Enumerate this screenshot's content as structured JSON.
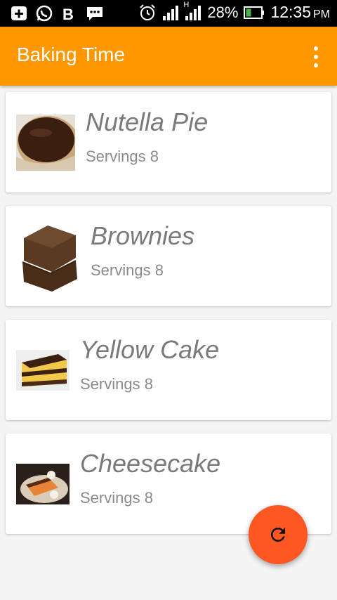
{
  "status_bar": {
    "battery_percent": "28%",
    "time": "12:35",
    "ampm": "PM",
    "network_type": "H",
    "left_icons": [
      "add-box-icon",
      "whatsapp-icon",
      "b-app-icon",
      "chat-bubble-icon"
    ],
    "right_icons": [
      "alarm-icon",
      "signal-icon",
      "signal-h-icon",
      "battery-icon"
    ]
  },
  "app_bar": {
    "title": "Baking Time",
    "color": "#ff9800",
    "menu_icon": "overflow-menu-icon"
  },
  "recipes": [
    {
      "name": "Nutella Pie",
      "servings": "Servings 8",
      "image": "nutella-pie-photo"
    },
    {
      "name": "Brownies",
      "servings": "Servings 8",
      "image": "brownies-photo"
    },
    {
      "name": "Yellow Cake",
      "servings": "Servings 8",
      "image": "yellow-cake-photo"
    },
    {
      "name": "Cheesecake",
      "servings": "Servings 8",
      "image": "cheesecake-photo"
    }
  ],
  "fab": {
    "icon": "refresh-icon",
    "color": "#ff5722"
  }
}
